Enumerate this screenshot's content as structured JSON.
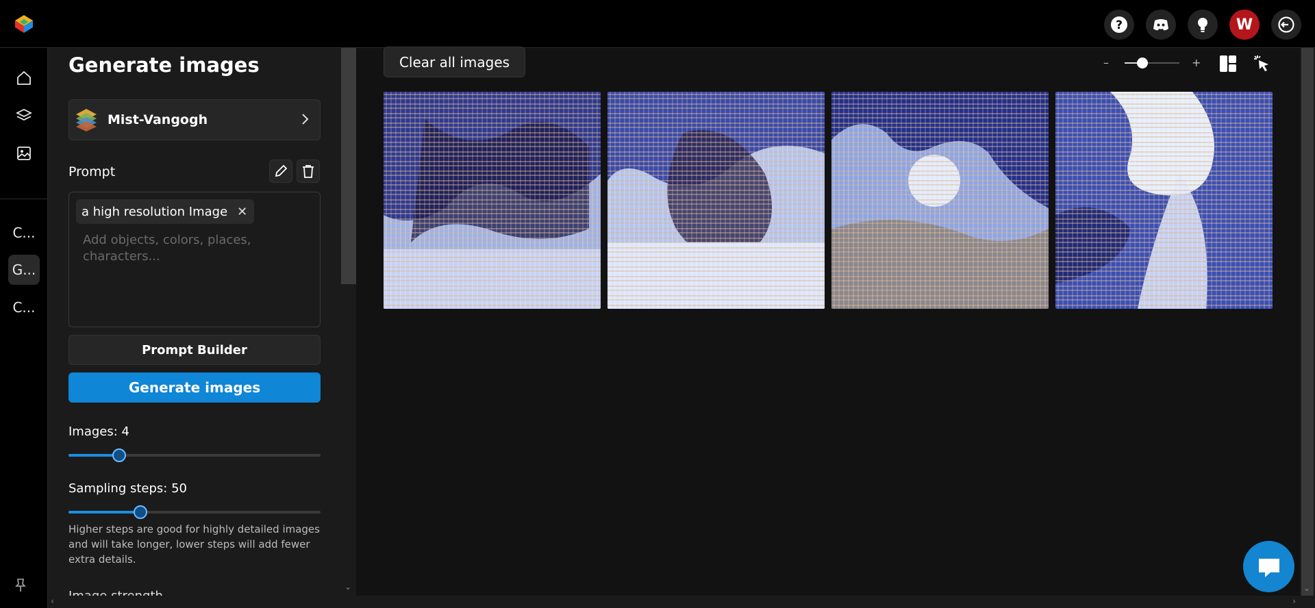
{
  "topbar": {
    "avatar_letter": "W",
    "help_icon": "question-icon",
    "discord_icon": "discord-icon",
    "ideas_icon": "lightbulb-icon",
    "logout_icon": "logout-icon"
  },
  "rail": {
    "items": [
      {
        "icon": "home-icon"
      },
      {
        "icon": "layers-icon"
      },
      {
        "icon": "image-icon"
      }
    ],
    "recent": [
      {
        "label": "C..."
      },
      {
        "label": "G..."
      },
      {
        "label": "C..."
      }
    ],
    "pin_icon": "pin-icon"
  },
  "panel": {
    "title": "Generate images",
    "model": {
      "name": "Mist-Vangogh"
    },
    "prompt_label": "Prompt",
    "prompt_chip": "a high resolution Image",
    "prompt_placeholder": "Add objects, colors, places, characters...",
    "builder_label": "Prompt Builder",
    "generate_label": "Generate images",
    "images_label": "Images: 4",
    "images_value": 4,
    "steps_label": "Sampling steps: 50",
    "steps_value": 50,
    "steps_hint": "Higher steps are good for highly detailed images and will take longer, lower steps will add fewer extra details.",
    "cutoff_label": "Image strength"
  },
  "main": {
    "clear_label": "Clear all images",
    "zoom_minus": "–",
    "zoom_plus": "+",
    "zoom_level": 0.4,
    "images_count": 4
  },
  "colors": {
    "accent": "#0f86d6",
    "avatar_bg": "#b3161b",
    "background": "#121212"
  }
}
